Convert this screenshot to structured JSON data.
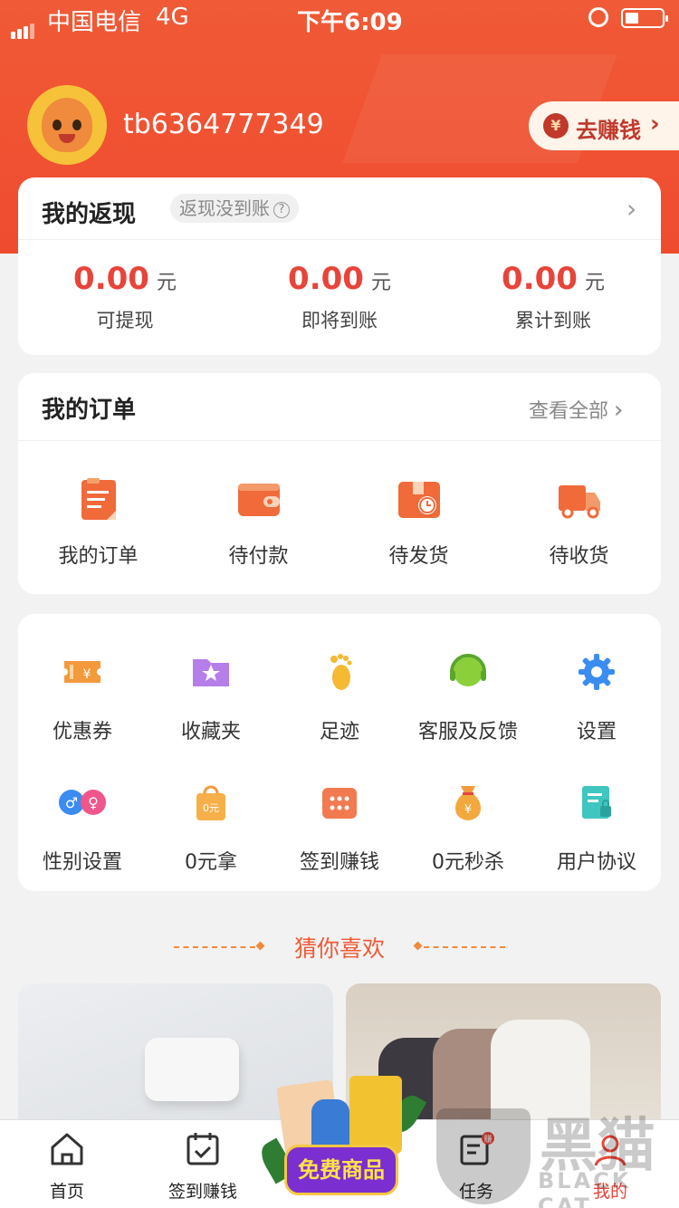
{
  "status_bar": {
    "carrier": "中国电信",
    "network": "4G",
    "time": "下午6:09"
  },
  "profile": {
    "username": "tb6364777349",
    "earn_button": "去赚钱",
    "earn_icon": "¥",
    "chevron": "›"
  },
  "cashback": {
    "title": "我的返现",
    "help_pill": "返现没到账",
    "help_icon": "?",
    "stats": [
      {
        "value": "0.00",
        "unit": "元",
        "label": "可提现"
      },
      {
        "value": "0.00",
        "unit": "元",
        "label": "即将到账"
      },
      {
        "value": "0.00",
        "unit": "元",
        "label": "累计到账"
      }
    ]
  },
  "orders": {
    "title": "我的订单",
    "view_all": "查看全部",
    "items": [
      {
        "label": "我的订单",
        "icon": "clipboard-icon"
      },
      {
        "label": "待付款",
        "icon": "wallet-icon"
      },
      {
        "label": "待发货",
        "icon": "package-clock-icon"
      },
      {
        "label": "待收货",
        "icon": "truck-icon"
      }
    ]
  },
  "tools": [
    {
      "label": "优惠券",
      "icon": "coupon-icon"
    },
    {
      "label": "收藏夹",
      "icon": "favorites-folder-icon"
    },
    {
      "label": "足迹",
      "icon": "footprint-icon"
    },
    {
      "label": "客服及反馈",
      "icon": "headset-icon"
    },
    {
      "label": "设置",
      "icon": "gear-icon"
    },
    {
      "label": "性别设置",
      "icon": "gender-icon"
    },
    {
      "label": "0元拿",
      "icon": "zero-yuan-bag-icon"
    },
    {
      "label": "签到赚钱",
      "icon": "checkin-calendar-icon"
    },
    {
      "label": "0元秒杀",
      "icon": "money-bag-icon"
    },
    {
      "label": "用户协议",
      "icon": "agreement-scroll-icon"
    }
  ],
  "icon_glyphs": {
    "yen": "¥",
    "zero_yuan": "0元",
    "male": "♂",
    "female": "♀"
  },
  "recommend": {
    "title": "猜你喜欢"
  },
  "tab_bar": {
    "items": [
      {
        "label": "首页",
        "icon": "home-icon"
      },
      {
        "label": "签到赚钱",
        "icon": "calendar-check-icon"
      },
      {
        "label": "任务",
        "icon": "task-icon"
      },
      {
        "label": "我的",
        "icon": "profile-icon"
      }
    ],
    "promo_label": "免费商品",
    "task_badge": "赚"
  },
  "watermark": {
    "cn": "黑猫",
    "en": "BLACK CAT"
  },
  "colors": {
    "brand": "#f05a36",
    "price": "#e8443a",
    "accent": "#f08a3c"
  }
}
